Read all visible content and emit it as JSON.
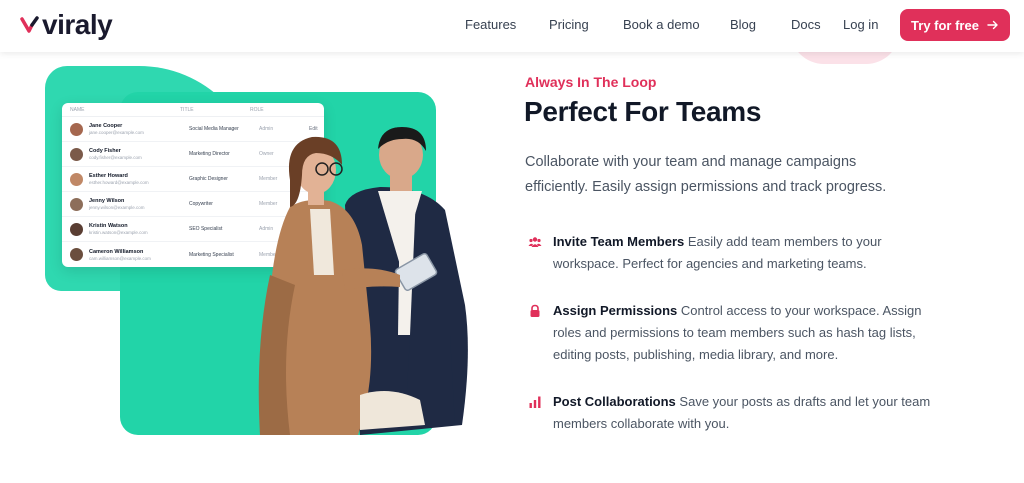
{
  "brand": {
    "name": "viraly",
    "accent": "#e0305a",
    "teal": "#22d4a8"
  },
  "nav": {
    "items": [
      "Features",
      "Pricing",
      "Book a demo",
      "Blog",
      "Docs"
    ],
    "login": "Log in",
    "cta": "Try for free",
    "cta_icon": "arrow-right-icon"
  },
  "team_card": {
    "headers": [
      "Name",
      "Title",
      "Role"
    ],
    "rows": [
      {
        "name": "Jane Cooper",
        "email": "jane.cooper@example.com",
        "title": "Social Media Manager",
        "role": "Admin",
        "action": "Edit"
      },
      {
        "name": "Cody Fisher",
        "email": "cody.fisher@example.com",
        "title": "Marketing Director",
        "role": "Owner",
        "action": ""
      },
      {
        "name": "Esther Howard",
        "email": "esther.howard@example.com",
        "title": "Graphic Designer",
        "role": "Member",
        "action": ""
      },
      {
        "name": "Jenny Wilson",
        "email": "jenny.wilson@example.com",
        "title": "Copywriter",
        "role": "Member",
        "action": ""
      },
      {
        "name": "Kristin Watson",
        "email": "kristin.watson@example.com",
        "title": "SEO Specialist",
        "role": "Admin",
        "action": ""
      },
      {
        "name": "Cameron Williamson",
        "email": "cam.williamson@example.com",
        "title": "Marketing Specialist",
        "role": "Member",
        "action": ""
      }
    ]
  },
  "section": {
    "eyebrow": "Always In The Loop",
    "title": "Perfect For Teams",
    "description": "Collaborate with your team and manage campaigns efficiently. Easily assign permissions and track progress."
  },
  "features": [
    {
      "icon": "users-icon",
      "title": "Invite Team Members",
      "text": "Easily add team members to your workspace. Perfect for agencies and marketing teams."
    },
    {
      "icon": "lock-icon",
      "title": "Assign Permissions",
      "text": "Control access to your workspace. Assign roles and permissions to team members such as hash tag lists, editing posts, publishing, media library, and more."
    },
    {
      "icon": "bar-chart-icon",
      "title": "Post Collaborations",
      "text": "Save your posts as drafts and let your team members collaborate with you."
    }
  ]
}
